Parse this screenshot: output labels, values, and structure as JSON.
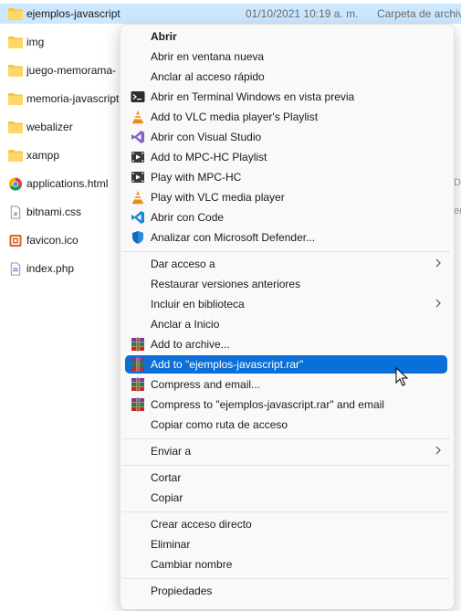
{
  "files": [
    {
      "name": "ejemplos-javascript",
      "date": "01/10/2021 10:19 a. m.",
      "type": "Carpeta de archivos",
      "icon": "folder-icon"
    },
    {
      "name": "img",
      "icon": "folder-icon"
    },
    {
      "name": "juego-memorama-",
      "icon": "folder-icon"
    },
    {
      "name": "memoria-javascript",
      "icon": "folder-icon"
    },
    {
      "name": "webalizer",
      "icon": "folder-icon"
    },
    {
      "name": "xampp",
      "icon": "folder-icon"
    },
    {
      "name": "applications.html",
      "icon": "chrome-html-icon"
    },
    {
      "name": "bitnami.css",
      "icon": "css-file-icon"
    },
    {
      "name": "favicon.ico",
      "icon": "ico-file-icon"
    },
    {
      "name": "index.php",
      "icon": "php-file-icon"
    }
  ],
  "peek": {
    "row7": "Do",
    "row8": "er"
  },
  "menu": {
    "open": "Abrir",
    "open_new_window": "Abrir en ventana nueva",
    "pin_quick_access": "Anclar al acceso rápido",
    "open_terminal": "Abrir en Terminal Windows en vista previa",
    "vlc_playlist": "Add to VLC media player's Playlist",
    "open_visual_studio": "Abrir con Visual Studio",
    "mpc_playlist": "Add to MPC-HC Playlist",
    "play_mpc": "Play with MPC-HC",
    "play_vlc": "Play with VLC media player",
    "open_code": "Abrir con Code",
    "defender": "Analizar con Microsoft Defender...",
    "give_access": "Dar acceso a",
    "restore_versions": "Restaurar versiones anteriores",
    "include_library": "Incluir en biblioteca",
    "pin_start": "Anclar a Inicio",
    "add_archive": "Add to archive...",
    "add_rar": "Add to \"ejemplos-javascript.rar\"",
    "compress_email": "Compress and email...",
    "compress_rar_email": "Compress to \"ejemplos-javascript.rar\" and email",
    "copy_path": "Copiar como ruta de acceso",
    "send_to": "Enviar a",
    "cut": "Cortar",
    "copy": "Copiar",
    "create_shortcut": "Crear acceso directo",
    "delete": "Eliminar",
    "rename": "Cambiar nombre",
    "properties": "Propiedades"
  },
  "colors": {
    "selection": "#cce8ff",
    "highlight": "#0a6fd8",
    "folder": "#f5c542"
  }
}
